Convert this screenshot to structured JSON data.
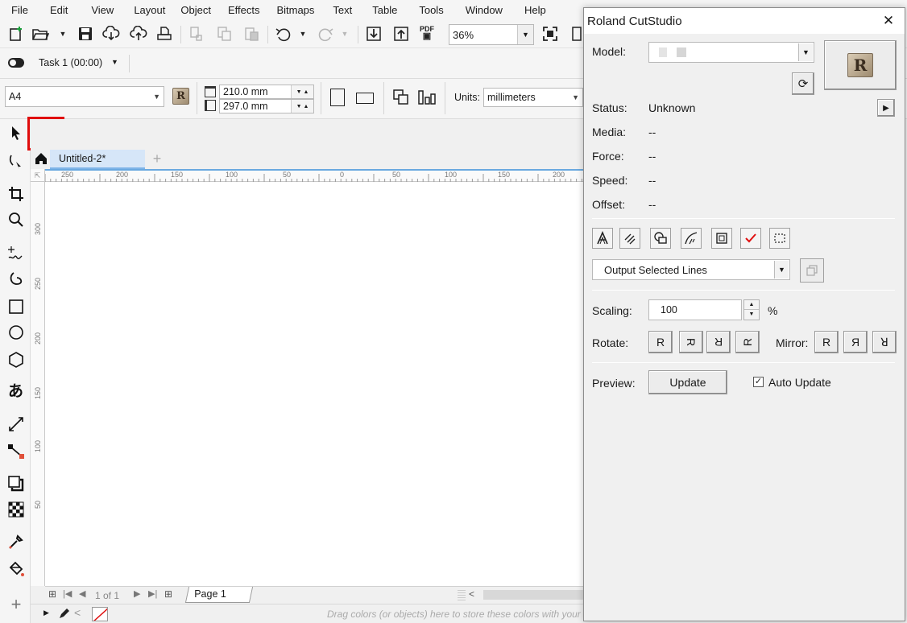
{
  "menu": [
    "File",
    "Edit",
    "View",
    "Layout",
    "Object",
    "Effects",
    "Bitmaps",
    "Text",
    "Table",
    "Tools",
    "Window",
    "Help"
  ],
  "toolbar": {
    "zoom_value": "36%",
    "pdf_label": "PDF"
  },
  "task": {
    "label": "Task 1 (00:00)"
  },
  "propbar": {
    "page_size": "A4",
    "width": "210.0 mm",
    "height": "297.0 mm",
    "units_label": "Units:",
    "units_value": "millimeters"
  },
  "document": {
    "tab_title": "Untitled-2*",
    "ruler_h_labels": [
      "250",
      "200",
      "150",
      "100",
      "50",
      "0",
      "50",
      "100",
      "150",
      "200"
    ],
    "ruler_v_labels": [
      "300",
      "250",
      "200",
      "150",
      "100",
      "50"
    ],
    "page_nav": "1 of 1",
    "page_tab": "Page 1",
    "status_hint": "Drag colors (or objects) here to store these colors with your document"
  },
  "dialog": {
    "title": "Roland CutStudio",
    "model_label": "Model:",
    "model_value": "",
    "status_label": "Status:",
    "status_value": "Unknown",
    "media_label": "Media:",
    "media_value": "--",
    "force_label": "Force:",
    "force_value": "--",
    "speed_label": "Speed:",
    "speed_value": "--",
    "offset_label": "Offset:",
    "offset_value": "--",
    "output_option": "Output Selected Lines",
    "scaling_label": "Scaling:",
    "scaling_value": "100",
    "scaling_unit": "%",
    "rotate_label": "Rotate:",
    "mirror_label": "Mirror:",
    "rotate_glyph": "R",
    "mirror_glyphs": [
      "R",
      "Я",
      "ꓤ"
    ],
    "preview_label": "Preview:",
    "update_button": "Update",
    "auto_update_label": "Auto Update",
    "auto_update_checked": true,
    "plugin_glyph": "R",
    "close_glyph": "✕"
  }
}
